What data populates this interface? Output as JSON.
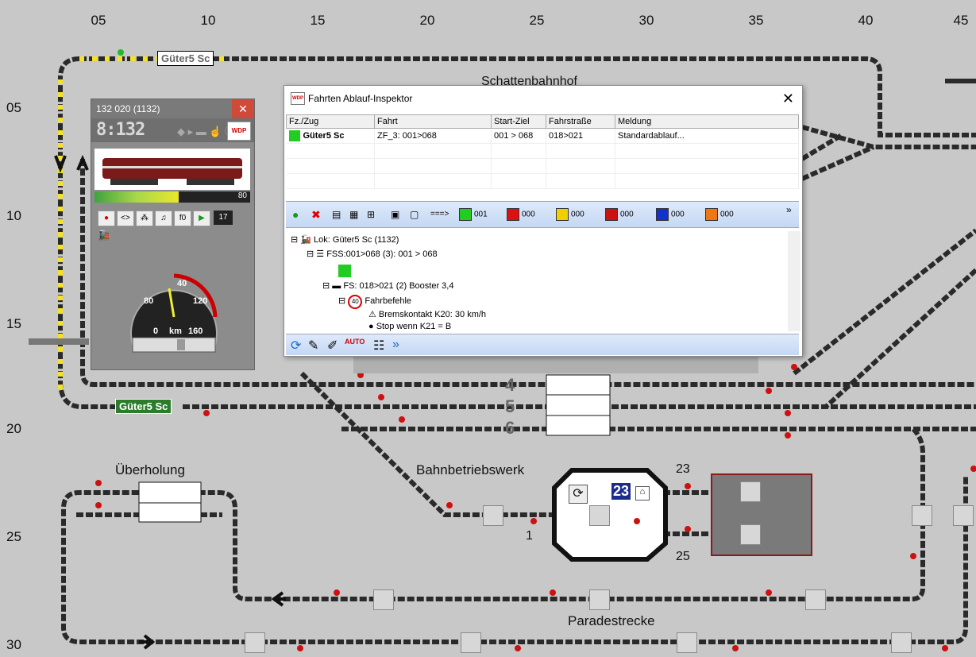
{
  "grid": {
    "columns": [
      "05",
      "10",
      "15",
      "20",
      "25",
      "30",
      "35",
      "40",
      "45"
    ],
    "rows": [
      "05",
      "10",
      "15",
      "20",
      "25",
      "30"
    ]
  },
  "labels": {
    "schattenbahnhof": "Schattenbahnhof",
    "ueberholung": "Überholung",
    "bahnbetriebswerk": "Bahnbetriebswerk",
    "paradestrecke": "Paradestrecke",
    "track4": "4",
    "track5": "5",
    "track6": "6",
    "num23": "23",
    "num25": "25",
    "num1": "1",
    "turntable_num": "23"
  },
  "trains": {
    "top": "Güter5 Sc",
    "left": "Güter5 Sc"
  },
  "loco_panel": {
    "title": "132 020  (1132)",
    "close": "✕",
    "address": "8:132",
    "speed_bar_value": "80",
    "function_count": "17",
    "f0_label": "f0",
    "speedo_labels": [
      "40",
      "80",
      "120",
      "0",
      "km",
      "160"
    ],
    "wdp_label": "WDP"
  },
  "dialog": {
    "title": "Fahrten Ablauf-Inspektor",
    "close": "✕",
    "columns": [
      "Fz./Zug",
      "Fahrt",
      "Start-Ziel",
      "Fahrstraße",
      "Meldung"
    ],
    "rows": [
      {
        "zug": "Güter5 Sc",
        "fahrt": "ZF_3: 001>068",
        "start_ziel": "001 > 068",
        "fahrstrasse": "018>021",
        "meldung": "Standardablauf..."
      }
    ],
    "toolbar": {
      "arrow": "===>",
      "counters": [
        {
          "color": "#22cc22",
          "value": "001"
        },
        {
          "color": "#dd1111",
          "value": "000"
        },
        {
          "color": "#f0d000",
          "value": "000"
        },
        {
          "color": "#cc1111",
          "value": "000"
        },
        {
          "color": "#1133cc",
          "value": "000"
        },
        {
          "color": "#ee7711",
          "value": "000"
        }
      ],
      "more": "»"
    },
    "tree": {
      "lok": "Lok: Güter5 Sc (1132)",
      "fss": "FSS:001>068 (3): 001 > 068",
      "fs": "FS: 018>021 (2) Booster 3,4",
      "fahrbefehle": "Fahrbefehle",
      "speed_sign": "40",
      "brems": "Bremskontakt K20: 30 km/h",
      "stop": "Stop wenn K21 = B"
    }
  },
  "colors": {
    "background": "#c8c8c8",
    "track": "#2a2a2a",
    "track_active": "#f0e020"
  }
}
